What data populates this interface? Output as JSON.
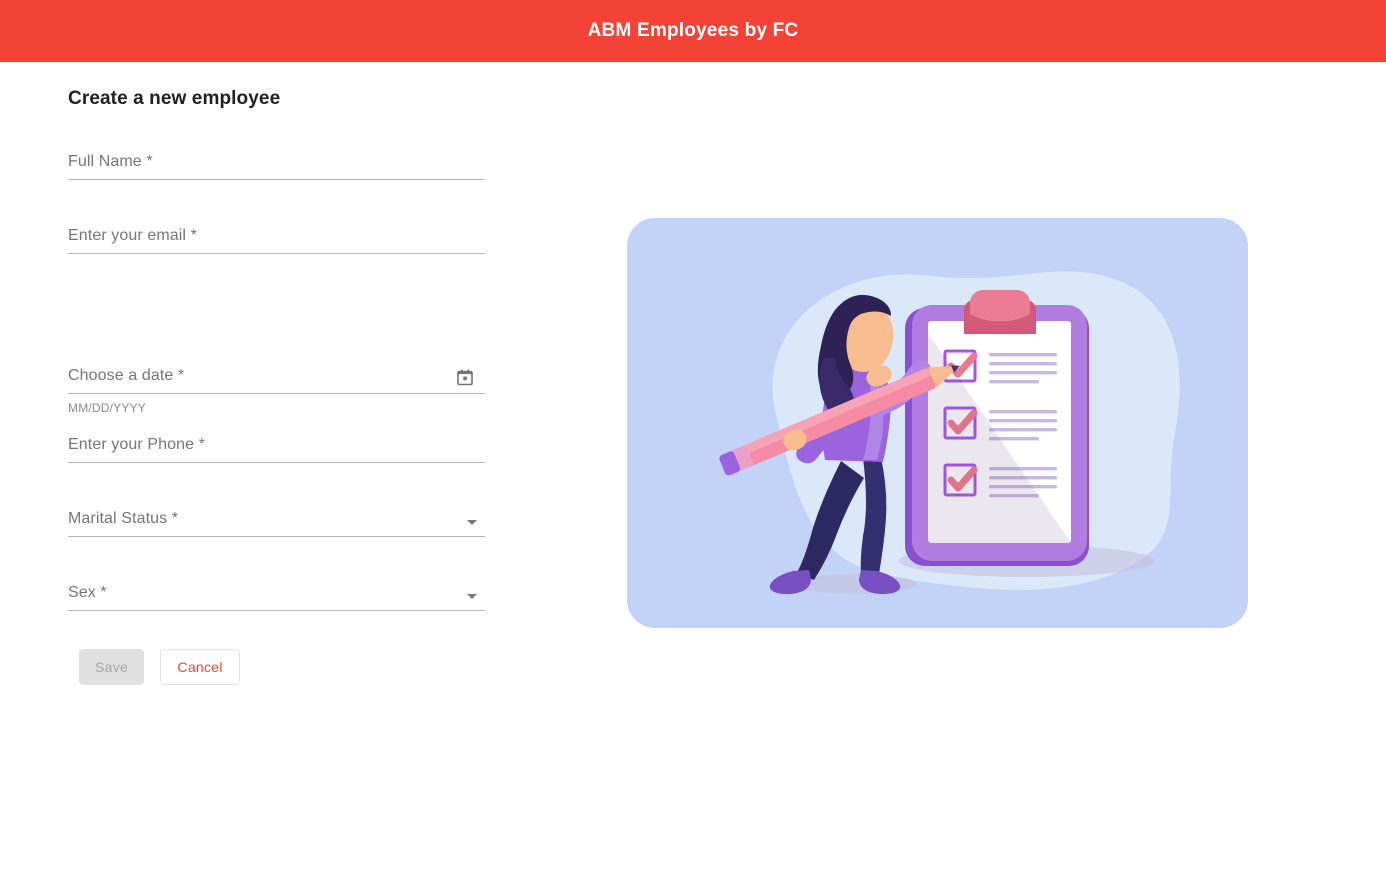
{
  "appbar": {
    "title": "ABM Employees by FC",
    "background": "#f44336",
    "text_color": "#ffffff"
  },
  "form": {
    "heading": "Create a new employee",
    "fields": [
      {
        "name": "full_name",
        "label": "Full Name *",
        "value": "",
        "type": "text",
        "hint": ""
      },
      {
        "name": "email",
        "label": "Enter your email *",
        "value": "",
        "type": "email",
        "hint": ""
      },
      {
        "name": "date",
        "label": "Choose a date *",
        "value": "",
        "type": "date",
        "hint": "MM/DD/YYYY",
        "icon": "calendar-icon"
      },
      {
        "name": "phone",
        "label": "Enter your Phone *",
        "value": "",
        "type": "tel",
        "hint": ""
      },
      {
        "name": "marital_status",
        "label": "Marital Status *",
        "value": "",
        "type": "select",
        "hint": "",
        "icon": "chevron-down-icon"
      },
      {
        "name": "sex",
        "label": "Sex *",
        "value": "",
        "type": "select",
        "hint": "",
        "icon": "chevron-down-icon"
      }
    ],
    "buttons": {
      "save": {
        "label": "Save",
        "disabled": true,
        "background": "#e0e0e0",
        "text_color": "#a6a6a6"
      },
      "cancel": {
        "label": "Cancel",
        "disabled": false,
        "background": "#ffffff",
        "text_color": "#f44336"
      }
    }
  },
  "illustration": {
    "name": "checklist-clipboard-illustration",
    "card_background": "#c3d2f7",
    "blob_color": "#dbe8fa",
    "clipboard_frame": "#b07ce0",
    "clipboard_frame_dark": "#8a4fd0",
    "paper": "#ffffff",
    "paper_shadow": "#d9cfe6",
    "clip_light": "#ea7c94",
    "clip_dark": "#d4587a",
    "check_color": "#ef7a8e",
    "checkbox_border": "#a855e8",
    "text_line_color": "#c9b8dd",
    "pencil_body": "#f58ba3",
    "pencil_body_light": "#f7a3b7",
    "skin": "#f7bd8f",
    "hair": "#2d2156",
    "shirt": "#9b63dd",
    "shirt_light": "#b184e8",
    "pants": "#2d2a63",
    "shoes": "#7b4fc4",
    "checklist_items": 3,
    "lines_per_item": 4
  }
}
